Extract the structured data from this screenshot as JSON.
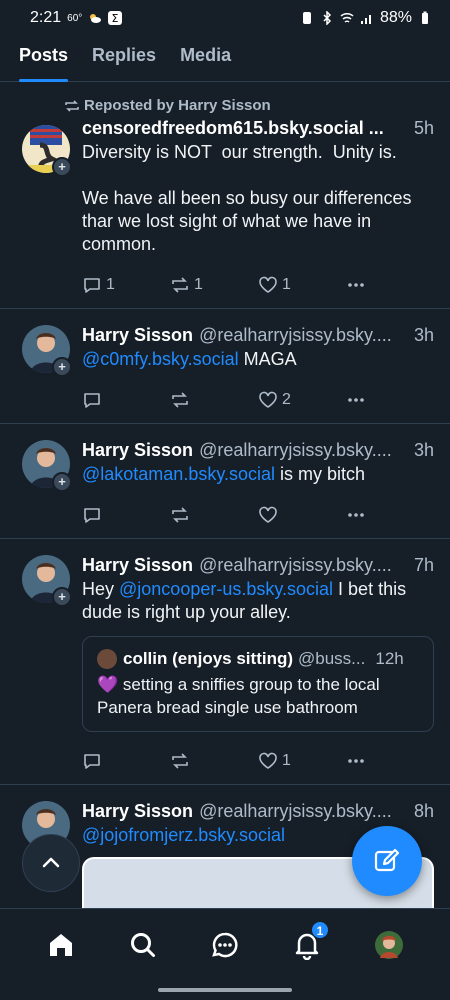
{
  "status_bar": {
    "time": "2:21",
    "temp": "60°",
    "battery": "88%"
  },
  "tabs": [
    {
      "label": "Posts",
      "active": true
    },
    {
      "label": "Replies",
      "active": false
    },
    {
      "label": "Media",
      "active": false
    }
  ],
  "posts": [
    {
      "repost_label": "Reposted by Harry Sisson",
      "name": "censoredfreedom615.bsky.social ...",
      "handle": "",
      "time": "5h",
      "text": "Diversity is NOT  our strength.  Unity is.\n\nWe have all been so busy our differences thar we lost sight of what we have in common.",
      "reply_count": "1",
      "repost_count": "1",
      "like_count": "1"
    },
    {
      "name": "Harry Sisson",
      "handle": "@realharryjsissy.bsky....",
      "time": "3h",
      "mention": "@c0mfy.bsky.social",
      "text_after": " MAGA",
      "reply_count": "",
      "repost_count": "",
      "like_count": "2"
    },
    {
      "name": "Harry Sisson",
      "handle": "@realharryjsissy.bsky....",
      "time": "3h",
      "mention": "@lakotaman.bsky.social",
      "text_after": " is my bitch",
      "reply_count": "",
      "repost_count": "",
      "like_count": ""
    },
    {
      "name": "Harry Sisson",
      "handle": "@realharryjsissy.bsky....",
      "time": "7h",
      "text_before": "Hey ",
      "mention": "@joncooper-us.bsky.social",
      "text_after": " I bet this dude is right up your alley.",
      "quote": {
        "name": "collin (enjoys sitting)",
        "handle": "@buss...",
        "time": "12h",
        "text": "💜 setting a sniffies group to the local Panera bread single use bathroom"
      },
      "reply_count": "",
      "repost_count": "",
      "like_count": "1"
    },
    {
      "name": "Harry Sisson",
      "handle": "@realharryjsissy.bsky....",
      "time": "8h",
      "mention": "@jojofromjerz.bsky.social"
    }
  ],
  "nav": {
    "notifications_badge": "1"
  },
  "colors": {
    "background": "#161e27",
    "accent": "#208bfe",
    "muted": "#aebbc9",
    "divider": "#2e4052"
  }
}
